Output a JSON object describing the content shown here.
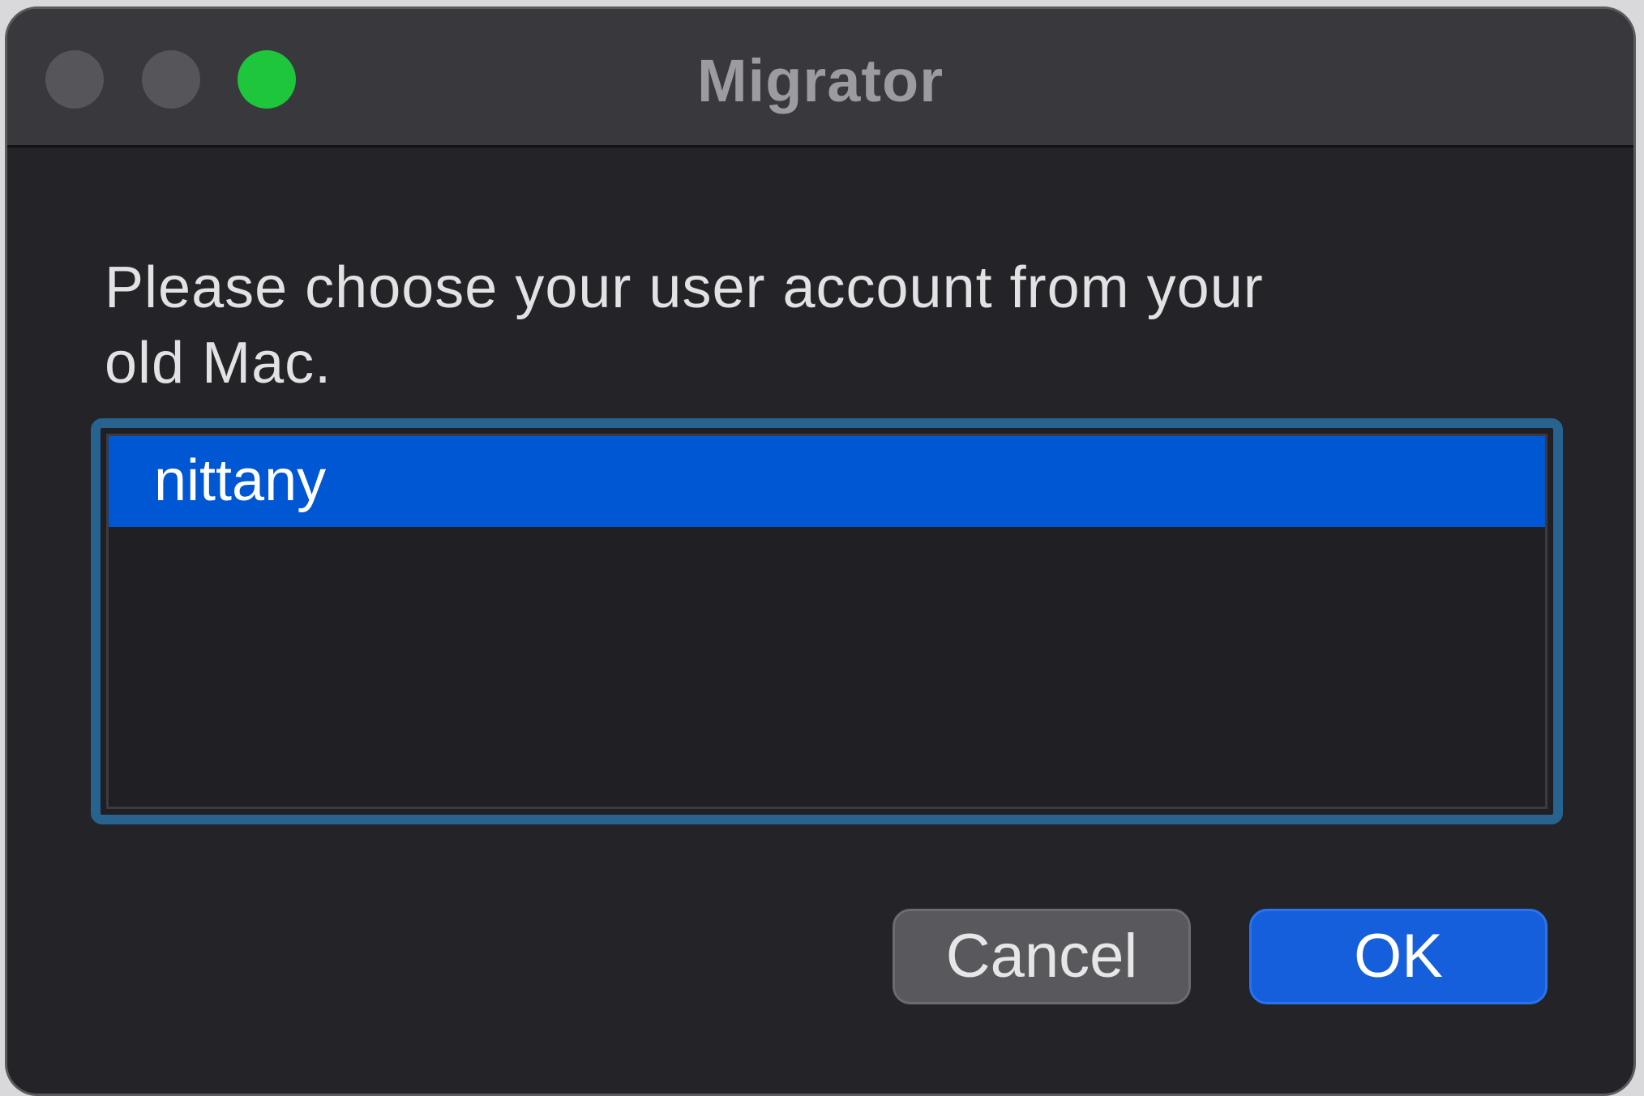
{
  "window": {
    "title": "Migrator",
    "traffic_lights": {
      "close_color": "#55555a",
      "minimize_color": "#55555a",
      "zoom_color": "#1dc63a"
    }
  },
  "dialog": {
    "prompt_line1": "Please choose your user account from your",
    "prompt_line2": "old Mac.",
    "accounts": [
      {
        "name": "nittany",
        "selected": true
      }
    ],
    "selection_color": "#0057d3",
    "focus_ring_color": "#28628f"
  },
  "buttons": {
    "cancel_label": "Cancel",
    "ok_label": "OK",
    "ok_color": "#155fdc"
  }
}
